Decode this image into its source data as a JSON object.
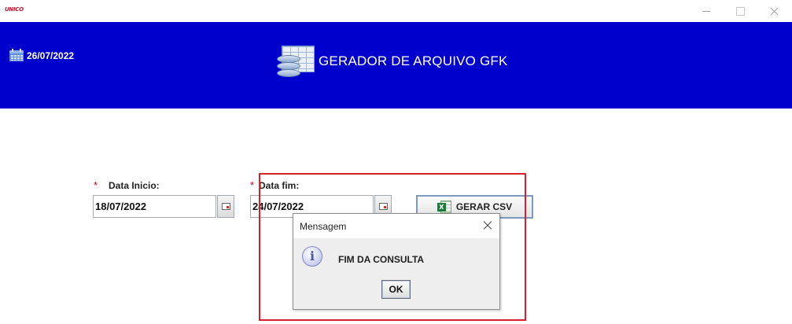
{
  "window": {
    "logo_text": "UNICO",
    "minimize_icon": "minimize-icon",
    "maximize_icon": "maximize-icon",
    "close_icon": "close-icon"
  },
  "header": {
    "date": "26/07/2022",
    "date_icon": "calendar-icon",
    "title": "GERADOR DE ARQUIVO GFK",
    "title_icon": "database-icon",
    "background_color": "#0000cc"
  },
  "form": {
    "required_marker": "*",
    "start": {
      "label": "Data Inicio:",
      "value": "18/07/2022",
      "picker_icon": "calendar-picker-icon"
    },
    "end": {
      "label": "Data fim:",
      "value": "24/07/2022",
      "picker_icon": "calendar-picker-icon"
    },
    "generate_button": {
      "label": "GERAR CSV",
      "icon": "excel-icon"
    }
  },
  "dialog": {
    "title": "Mensagem",
    "close_icon": "close-icon",
    "icon": "info-icon",
    "message": "FIM DA CONSULTA",
    "ok_label": "OK"
  },
  "highlight_color": "#d9202a"
}
